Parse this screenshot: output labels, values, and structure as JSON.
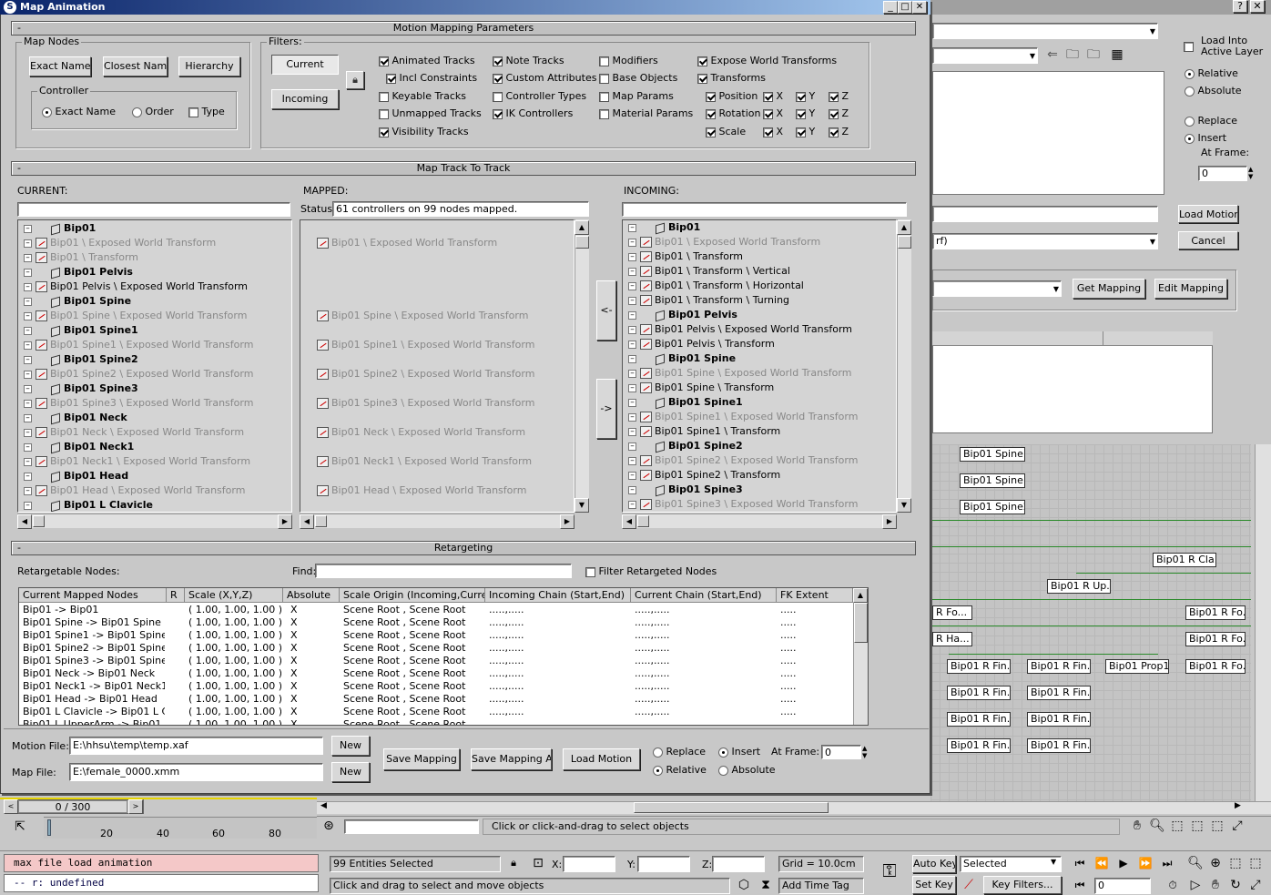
{
  "window": {
    "title": "Map Animation"
  },
  "rollouts": {
    "motion_mapping": "Motion Mapping Parameters",
    "map_track": "Map Track To Track",
    "retargeting": "Retargeting"
  },
  "map_nodes": {
    "label": "Map Nodes",
    "exact": "Exact Name",
    "closest": "Closest Name",
    "hierarchy": "Hierarchy"
  },
  "controller": {
    "label": "Controller",
    "exact": "Exact Name",
    "order": "Order",
    "type": "Type"
  },
  "filters": {
    "label": "Filters:",
    "current": "Current",
    "incoming": "Incoming",
    "c1": [
      "Animated Tracks",
      "Incl Constraints",
      "Keyable Tracks",
      "Unmapped Tracks",
      "Visibility Tracks"
    ],
    "c2": [
      "Note Tracks",
      "Custom Attributes",
      "Controller Types",
      "IK Controllers"
    ],
    "c3": [
      "Modifiers",
      "Base Objects",
      "Map Params",
      "Material Params"
    ],
    "c4": [
      "Expose World Transforms",
      "Transforms",
      "Position",
      "Rotation",
      "Scale"
    ],
    "axes": [
      "X",
      "Y",
      "Z"
    ]
  },
  "track": {
    "current_label": "CURRENT:",
    "mapped_label": "MAPPED:",
    "incoming_label": "INCOMING:",
    "status_label": "Status:",
    "status_value": "61 controllers on 99 nodes mapped.",
    "btn_left": "<-",
    "btn_right": "->",
    "current": [
      {
        "t": "Bip01",
        "k": "n"
      },
      {
        "t": "Bip01 \\ Exposed World Transform",
        "k": "g"
      },
      {
        "t": "Bip01 \\ Transform",
        "k": "g"
      },
      {
        "t": "Bip01 Pelvis",
        "k": "n"
      },
      {
        "t": "Bip01 Pelvis \\ Exposed World Transform",
        "k": "b"
      },
      {
        "t": "Bip01 Spine",
        "k": "n"
      },
      {
        "t": "Bip01 Spine \\ Exposed World Transform",
        "k": "g"
      },
      {
        "t": "Bip01 Spine1",
        "k": "n"
      },
      {
        "t": "Bip01 Spine1 \\ Exposed World Transform",
        "k": "g"
      },
      {
        "t": "Bip01 Spine2",
        "k": "n"
      },
      {
        "t": "Bip01 Spine2 \\ Exposed World Transform",
        "k": "g"
      },
      {
        "t": "Bip01 Spine3",
        "k": "n"
      },
      {
        "t": "Bip01 Spine3 \\ Exposed World Transform",
        "k": "g"
      },
      {
        "t": "Bip01 Neck",
        "k": "n"
      },
      {
        "t": "Bip01 Neck \\ Exposed World Transform",
        "k": "g"
      },
      {
        "t": "Bip01 Neck1",
        "k": "n"
      },
      {
        "t": "Bip01 Neck1 \\ Exposed World Transform",
        "k": "g"
      },
      {
        "t": "Bip01 Head",
        "k": "n"
      },
      {
        "t": "Bip01 Head \\ Exposed World Transform",
        "k": "g"
      },
      {
        "t": "Bip01 L Clavicle",
        "k": "n"
      }
    ],
    "mapped": [
      "",
      "Bip01 \\ Exposed World Transform",
      "",
      "",
      "",
      "",
      "Bip01 Spine \\ Exposed World Transform",
      "",
      "Bip01 Spine1 \\ Exposed World Transform",
      "",
      "Bip01 Spine2 \\ Exposed World Transform",
      "",
      "Bip01 Spine3 \\ Exposed World Transform",
      "",
      "Bip01 Neck \\ Exposed World Transform",
      "",
      "Bip01 Neck1 \\ Exposed World Transform",
      "",
      "Bip01 Head \\ Exposed World Transform",
      ""
    ],
    "incoming": [
      {
        "t": "Bip01",
        "k": "n"
      },
      {
        "t": "Bip01 \\ Exposed World Transform",
        "k": "g"
      },
      {
        "t": "Bip01 \\ Transform",
        "k": "b"
      },
      {
        "t": "Bip01 \\ Transform \\ Vertical",
        "k": "b"
      },
      {
        "t": "Bip01 \\ Transform \\ Horizontal",
        "k": "b"
      },
      {
        "t": "Bip01 \\ Transform \\ Turning",
        "k": "b"
      },
      {
        "t": "Bip01 Pelvis",
        "k": "n"
      },
      {
        "t": "Bip01 Pelvis \\ Exposed World Transform",
        "k": "b"
      },
      {
        "t": "Bip01 Pelvis \\ Transform",
        "k": "b"
      },
      {
        "t": "Bip01 Spine",
        "k": "n"
      },
      {
        "t": "Bip01 Spine \\ Exposed World Transform",
        "k": "g"
      },
      {
        "t": "Bip01 Spine \\ Transform",
        "k": "b"
      },
      {
        "t": "Bip01 Spine1",
        "k": "n"
      },
      {
        "t": "Bip01 Spine1 \\ Exposed World Transform",
        "k": "g"
      },
      {
        "t": "Bip01 Spine1 \\ Transform",
        "k": "b"
      },
      {
        "t": "Bip01 Spine2",
        "k": "n"
      },
      {
        "t": "Bip01 Spine2 \\ Exposed World Transform",
        "k": "g"
      },
      {
        "t": "Bip01 Spine2 \\ Transform",
        "k": "b"
      },
      {
        "t": "Bip01 Spine3",
        "k": "n"
      },
      {
        "t": "Bip01 Spine3 \\ Exposed World Transform",
        "k": "g"
      }
    ]
  },
  "retarget": {
    "nodes_label": "Retargetable Nodes:",
    "find_label": "Find:",
    "filter_label": "Filter Retargeted Nodes",
    "headers": [
      "Current Mapped Nodes",
      "R",
      "Scale (X,Y,Z)",
      "Absolute",
      "Scale Origin (Incoming,Current)",
      "Incoming Chain (Start,End)",
      "Current Chain (Start,End)",
      "FK Extent"
    ],
    "rows": [
      [
        "Bip01 -> Bip01",
        "",
        "( 1.00, 1.00, 1.00 )",
        "X",
        "Scene Root , Scene Root",
        ".....,.....",
        ".....,.....",
        "....."
      ],
      [
        "Bip01 Spine -> Bip01 Spine",
        "",
        "( 1.00, 1.00, 1.00 )",
        "X",
        "Scene Root , Scene Root",
        ".....,.....",
        ".....,.....",
        "....."
      ],
      [
        "Bip01 Spine1 -> Bip01 Spine1",
        "",
        "( 1.00, 1.00, 1.00 )",
        "X",
        "Scene Root , Scene Root",
        ".....,.....",
        ".....,.....",
        "....."
      ],
      [
        "Bip01 Spine2 -> Bip01 Spine2",
        "",
        "( 1.00, 1.00, 1.00 )",
        "X",
        "Scene Root , Scene Root",
        ".....,.....",
        ".....,.....",
        "....."
      ],
      [
        "Bip01 Spine3 -> Bip01 Spine3",
        "",
        "( 1.00, 1.00, 1.00 )",
        "X",
        "Scene Root , Scene Root",
        ".....,.....",
        ".....,.....",
        "....."
      ],
      [
        "Bip01 Neck -> Bip01 Neck",
        "",
        "( 1.00, 1.00, 1.00 )",
        "X",
        "Scene Root , Scene Root",
        ".....,.....",
        ".....,.....",
        "....."
      ],
      [
        "Bip01 Neck1 -> Bip01 Neck1",
        "",
        "( 1.00, 1.00, 1.00 )",
        "X",
        "Scene Root , Scene Root",
        ".....,.....",
        ".....,.....",
        "....."
      ],
      [
        "Bip01 Head -> Bip01 Head",
        "",
        "( 1.00, 1.00, 1.00 )",
        "X",
        "Scene Root , Scene Root",
        ".....,.....",
        ".....,.....",
        "....."
      ],
      [
        "Bip01 L Clavicle -> Bip01 L Cla...",
        "",
        "( 1.00, 1.00, 1.00 )",
        "X",
        "Scene Root , Scene Root",
        ".....,.....",
        ".....,.....",
        "....."
      ],
      [
        "Bip01 L UpperArm -> Bip01 L ...",
        "",
        "( 1.00, 1.00, 1.00 )",
        "X",
        "Scene Root , Scene Root",
        "",
        "",
        ""
      ]
    ]
  },
  "files": {
    "motion_label": "Motion File:",
    "motion_value": "E:\\hhsu\\temp\\temp.xaf",
    "map_label": "Map File:",
    "map_value": "E:\\female_0000.xmm",
    "new": "New",
    "save_mapping": "Save Mapping",
    "save_mapping_as": "Save Mapping As",
    "load_motion": "Load Motion",
    "replace": "Replace",
    "insert": "Insert",
    "at_frame": "At Frame:",
    "frame_value": "0",
    "relative": "Relative",
    "absolute": "Absolute"
  },
  "right_panel": {
    "load_into": "Load Into",
    "active_layer": "Active Layer",
    "relative": "Relative",
    "absolute": "Absolute",
    "replace": "Replace",
    "insert": "Insert",
    "at_frame": "At Frame:",
    "frame_value": "0",
    "load_motion": "Load Motion",
    "cancel": "Cancel",
    "combo_suffix": "rf)",
    "get_mapping": "Get Mapping",
    "edit_mapping": "Edit Mapping"
  },
  "schematic": [
    "Bip01 Spine",
    "Bip01 Spine1",
    "Bip01 Spine2",
    "Bip01 R Cla...",
    "Bip01 R Up...",
    "R Fo...",
    "Bip01 R Fo...",
    "R Ha...",
    "Bip01 R Fo...",
    "Bip01 R Fin...",
    "Bip01 R Fin...",
    "Bip01 Prop1",
    "Bip01 R Fo...",
    "Bip01 R Fin...",
    "Bip01 R Fin...",
    "Bip01 R Fin...",
    "Bip01 R Fin...",
    "Bip01 R Fin...",
    "Bip01 R Fin..."
  ],
  "timeline": {
    "frame": "0 / 300",
    "ticks": [
      "0",
      "20",
      "40",
      "60",
      "80"
    ]
  },
  "status": {
    "prompt": "Click or click-and-drag to select objects",
    "maxscript1": "max file load animation",
    "maxscript2": "--   r: undefined",
    "selected": "99 Entities Selected",
    "hint": "Click and drag to select and move objects",
    "x": "X:",
    "y": "Y:",
    "z": "Z:",
    "grid": "Grid = 10.0cm",
    "add_time_tag": "Add Time Tag",
    "auto_key": "Auto Key",
    "set_key": "Set Key",
    "selected_combo": "Selected",
    "key_filters": "Key Filters...",
    "frame": "0"
  }
}
